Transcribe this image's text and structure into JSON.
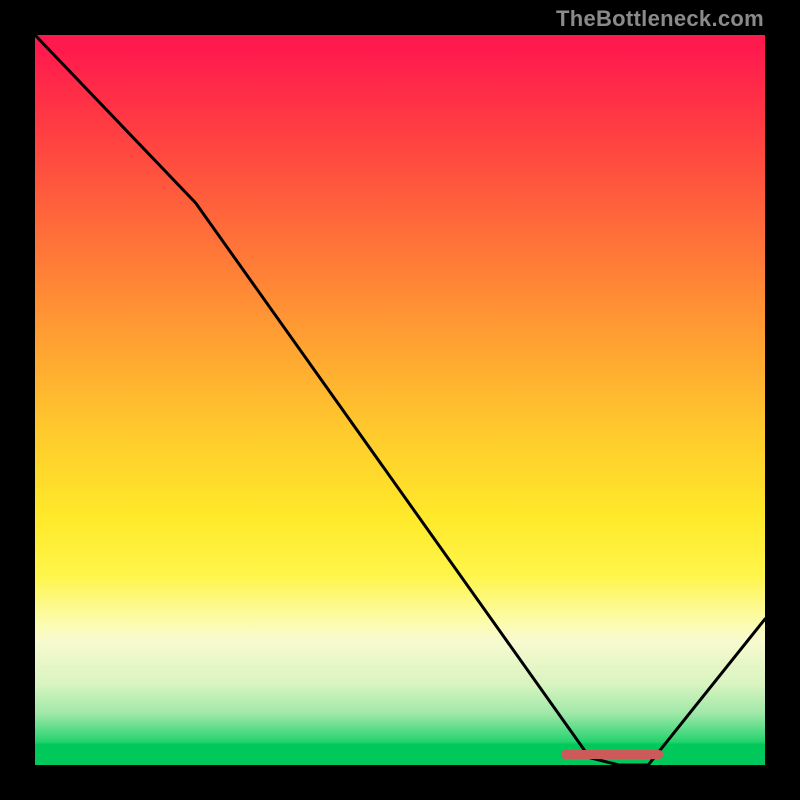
{
  "watermark": "TheBottleneck.com",
  "chart_data": {
    "type": "line",
    "title": "",
    "xlabel": "",
    "ylabel": "",
    "xlim": [
      0,
      100
    ],
    "ylim": [
      0,
      100
    ],
    "series": [
      {
        "name": "curve",
        "x": [
          0,
          22,
          76,
          80,
          84,
          100
        ],
        "values": [
          100,
          77,
          1,
          0,
          0,
          20
        ]
      }
    ],
    "annotations": [
      {
        "name": "highlight-bar",
        "x_start": 72,
        "x_end": 86,
        "y": 1.5,
        "color": "#cc5a5a"
      }
    ],
    "gradient_stops": [
      {
        "pos": 0.0,
        "color": "#ff1a4d"
      },
      {
        "pos": 0.4,
        "color": "#ff9a33"
      },
      {
        "pos": 0.66,
        "color": "#ffe92a"
      },
      {
        "pos": 0.83,
        "color": "#f8fad0"
      },
      {
        "pos": 0.97,
        "color": "#00c85a"
      },
      {
        "pos": 1.0,
        "color": "#00c85a"
      }
    ]
  }
}
